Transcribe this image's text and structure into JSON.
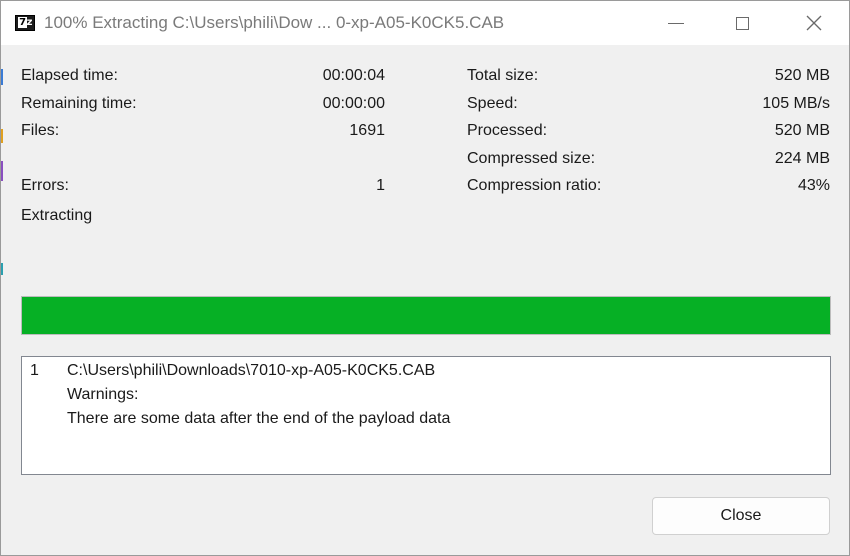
{
  "window": {
    "title": "100% Extracting C:\\Users\\phili\\Dow ... 0-xp-A05-K0CK5.CAB",
    "icon": "7z-app-icon",
    "controls": [
      "minimize-icon",
      "maximize-icon",
      "close-icon"
    ]
  },
  "stats_left": [
    {
      "label": "Elapsed time:",
      "value": "00:00:04"
    },
    {
      "label": "Remaining time:",
      "value": "00:00:00"
    },
    {
      "label": "Files:",
      "value": "1691"
    },
    {
      "label": "Errors:",
      "value": "1"
    }
  ],
  "stats_right": [
    {
      "label": "Total size:",
      "value": "520 MB"
    },
    {
      "label": "Speed:",
      "value": "105 MB/s"
    },
    {
      "label": "Processed:",
      "value": "520 MB"
    },
    {
      "label": "Compressed size:",
      "value": "224 MB"
    },
    {
      "label": "Compression ratio:",
      "value": "43%"
    }
  ],
  "status_text": "Extracting",
  "progress": {
    "percent": 100,
    "color": "#06b025"
  },
  "messages": {
    "index": "1",
    "path": "C:\\Users\\phili\\Downloads\\7010-xp-A05-K0CK5.CAB",
    "heading": "Warnings:",
    "detail": "There are some data after the end of the payload data"
  },
  "buttons": {
    "close_label": "Close"
  }
}
